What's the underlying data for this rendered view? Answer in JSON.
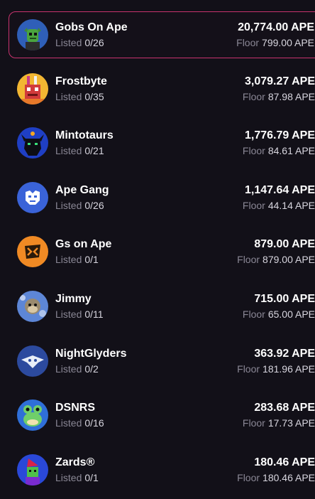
{
  "collections": [
    {
      "name": "Gobs On Ape",
      "listed_label": "Listed",
      "listed": "0/26",
      "volume": "20,774.00 APE",
      "floor_label": "Floor",
      "floor": "799.00 APE",
      "avatar_icon": "goblin-avatar-icon",
      "selected": true
    },
    {
      "name": "Frostbyte",
      "listed_label": "Listed",
      "listed": "0/35",
      "volume": "3,079.27 APE",
      "floor_label": "Floor",
      "floor": "87.98 APE",
      "avatar_icon": "robot-avatar-icon"
    },
    {
      "name": "Mintotaurs",
      "listed_label": "Listed",
      "listed": "0/21",
      "volume": "1,776.79 APE",
      "floor_label": "Floor",
      "floor": "84.61 APE",
      "avatar_icon": "minotaur-avatar-icon"
    },
    {
      "name": "Ape Gang",
      "listed_label": "Listed",
      "listed": "0/26",
      "volume": "1,147.64 APE",
      "floor_label": "Floor",
      "floor": "44.14 APE",
      "avatar_icon": "ape-logo-avatar-icon"
    },
    {
      "name": "Gs on Ape",
      "listed_label": "Listed",
      "listed": "0/1",
      "volume": "879.00 APE",
      "floor_label": "Floor",
      "floor": "879.00 APE",
      "avatar_icon": "gs-logo-avatar-icon"
    },
    {
      "name": "Jimmy",
      "listed_label": "Listed",
      "listed": "0/11",
      "volume": "715.00 APE",
      "floor_label": "Floor",
      "floor": "65.00 APE",
      "avatar_icon": "monkey-avatar-icon"
    },
    {
      "name": "NightGlyders",
      "listed_label": "Listed",
      "listed": "0/2",
      "volume": "363.92 APE",
      "floor_label": "Floor",
      "floor": "181.96 APE",
      "avatar_icon": "glider-avatar-icon"
    },
    {
      "name": "DSNRS",
      "listed_label": "Listed",
      "listed": "0/16",
      "volume": "283.68 APE",
      "floor_label": "Floor",
      "floor": "17.73 APE",
      "avatar_icon": "frog-avatar-icon"
    },
    {
      "name": "Zards®",
      "listed_label": "Listed",
      "listed": "0/1",
      "volume": "180.46 APE",
      "floor_label": "Floor",
      "floor": "180.46 APE",
      "avatar_icon": "wizard-avatar-icon"
    }
  ],
  "colors": {
    "background": "#121018",
    "selected_border": "#c8336e",
    "primary_text": "#ffffff",
    "muted_text": "#8a8795"
  }
}
